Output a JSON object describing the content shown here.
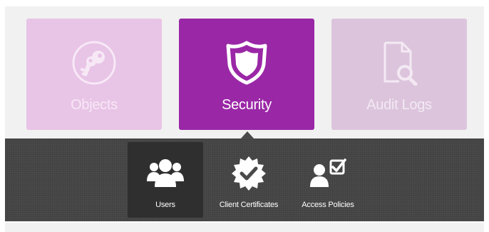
{
  "tiles": [
    {
      "label": "Objects",
      "icon": "keys-icon",
      "state": "inactive"
    },
    {
      "label": "Security",
      "icon": "shield-icon",
      "state": "active"
    },
    {
      "label": "Audit Logs",
      "icon": "document-search-icon",
      "state": "inactive"
    }
  ],
  "submenu": {
    "items": [
      {
        "label": "Users",
        "icon": "users-icon",
        "state": "selected"
      },
      {
        "label": "Client Certificates",
        "icon": "certificate-badge-icon",
        "state": "normal"
      },
      {
        "label": "Access Policies",
        "icon": "user-check-icon",
        "state": "normal"
      }
    ]
  },
  "colors": {
    "accent": "#9a27a6",
    "tile_objects": "#e8c4e6",
    "tile_audit": "#dcc5dc",
    "submenu_bg": "#4a4a4a",
    "submenu_selected": "#2f2f2f"
  }
}
